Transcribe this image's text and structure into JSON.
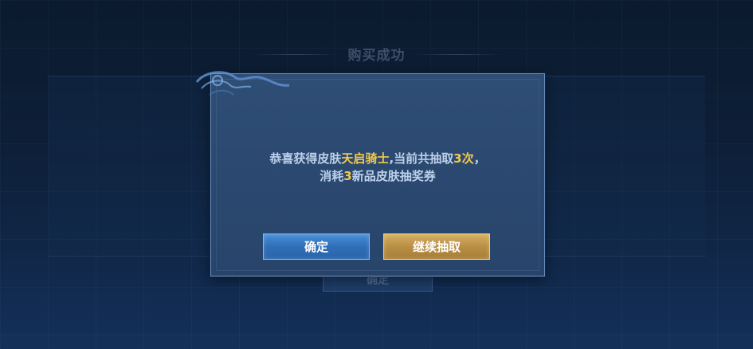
{
  "background": {
    "title": "购买成功",
    "confirm_label": "确定"
  },
  "dialog": {
    "line1_prefix": "恭喜获得皮肤",
    "skin_name": "天启骑士",
    "line1_mid": ",当前共抽取",
    "draw_count": "3次",
    "line1_suffix": "，",
    "line2_prefix": "消耗",
    "ticket_count": "3",
    "ticket_name": "新品皮肤抽奖券",
    "confirm_label": "确定",
    "continue_label": "继续抽取"
  },
  "colors": {
    "highlight": "#f3c94b",
    "confirm_button": "#2f6fb8",
    "continue_button": "#b98f45"
  }
}
